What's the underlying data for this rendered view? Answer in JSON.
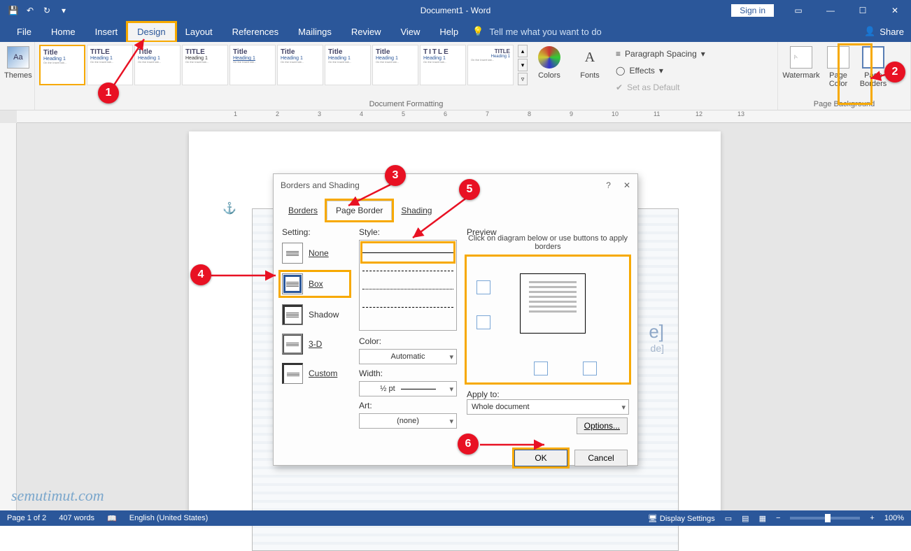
{
  "titlebar": {
    "document": "Document1 - Word",
    "signin": "Sign in"
  },
  "menu": {
    "items": [
      "File",
      "Home",
      "Insert",
      "Design",
      "Layout",
      "References",
      "Mailings",
      "Review",
      "View",
      "Help"
    ],
    "active_index": 3,
    "tellme_placeholder": "Tell me what you want to do",
    "share": "Share"
  },
  "ribbon": {
    "themes": "Themes",
    "formatting_label": "Document Formatting",
    "colors": "Colors",
    "fonts": "Fonts",
    "par_spacing": "Paragraph Spacing",
    "effects": "Effects",
    "set_default": "Set as Default",
    "watermark": "Watermark",
    "page_color": "Page Color",
    "page_borders": "Page Borders",
    "page_bg_label": "Page Background",
    "gallery_titles": [
      "Title",
      "TITLE",
      "Title",
      "TITLE",
      "Title",
      "Title",
      "Title",
      "Title",
      "TITLE",
      "TITLE"
    ],
    "gallery_heading": "Heading 1"
  },
  "dialog": {
    "title": "Borders and Shading",
    "tabs": {
      "borders": "Borders",
      "page_border": "Page Border",
      "shading": "Shading"
    },
    "setting_label": "Setting:",
    "settings": {
      "none": "None",
      "box": "Box",
      "shadow": "Shadow",
      "threeD": "3-D",
      "custom": "Custom"
    },
    "style_label": "Style:",
    "color_label": "Color:",
    "color_value": "Automatic",
    "width_label": "Width:",
    "width_value": "½ pt",
    "art_label": "Art:",
    "art_value": "(none)",
    "preview_label": "Preview",
    "preview_note": "Click on diagram below or use buttons to apply borders",
    "apply_to_label": "Apply to:",
    "apply_to_value": "Whole document",
    "options_btn": "Options...",
    "ok": "OK",
    "cancel": "Cancel"
  },
  "callouts": {
    "1": "1",
    "2": "2",
    "3": "3",
    "4": "4",
    "5": "5",
    "6": "6"
  },
  "statusbar": {
    "page": "Page 1 of 2",
    "words": "407 words",
    "lang": "English (United States)",
    "display": "Display Settings",
    "zoom": "100%"
  },
  "watermark_text": "semutimut.com",
  "cover": {
    "title": "e]",
    "subtitle": "de]"
  }
}
